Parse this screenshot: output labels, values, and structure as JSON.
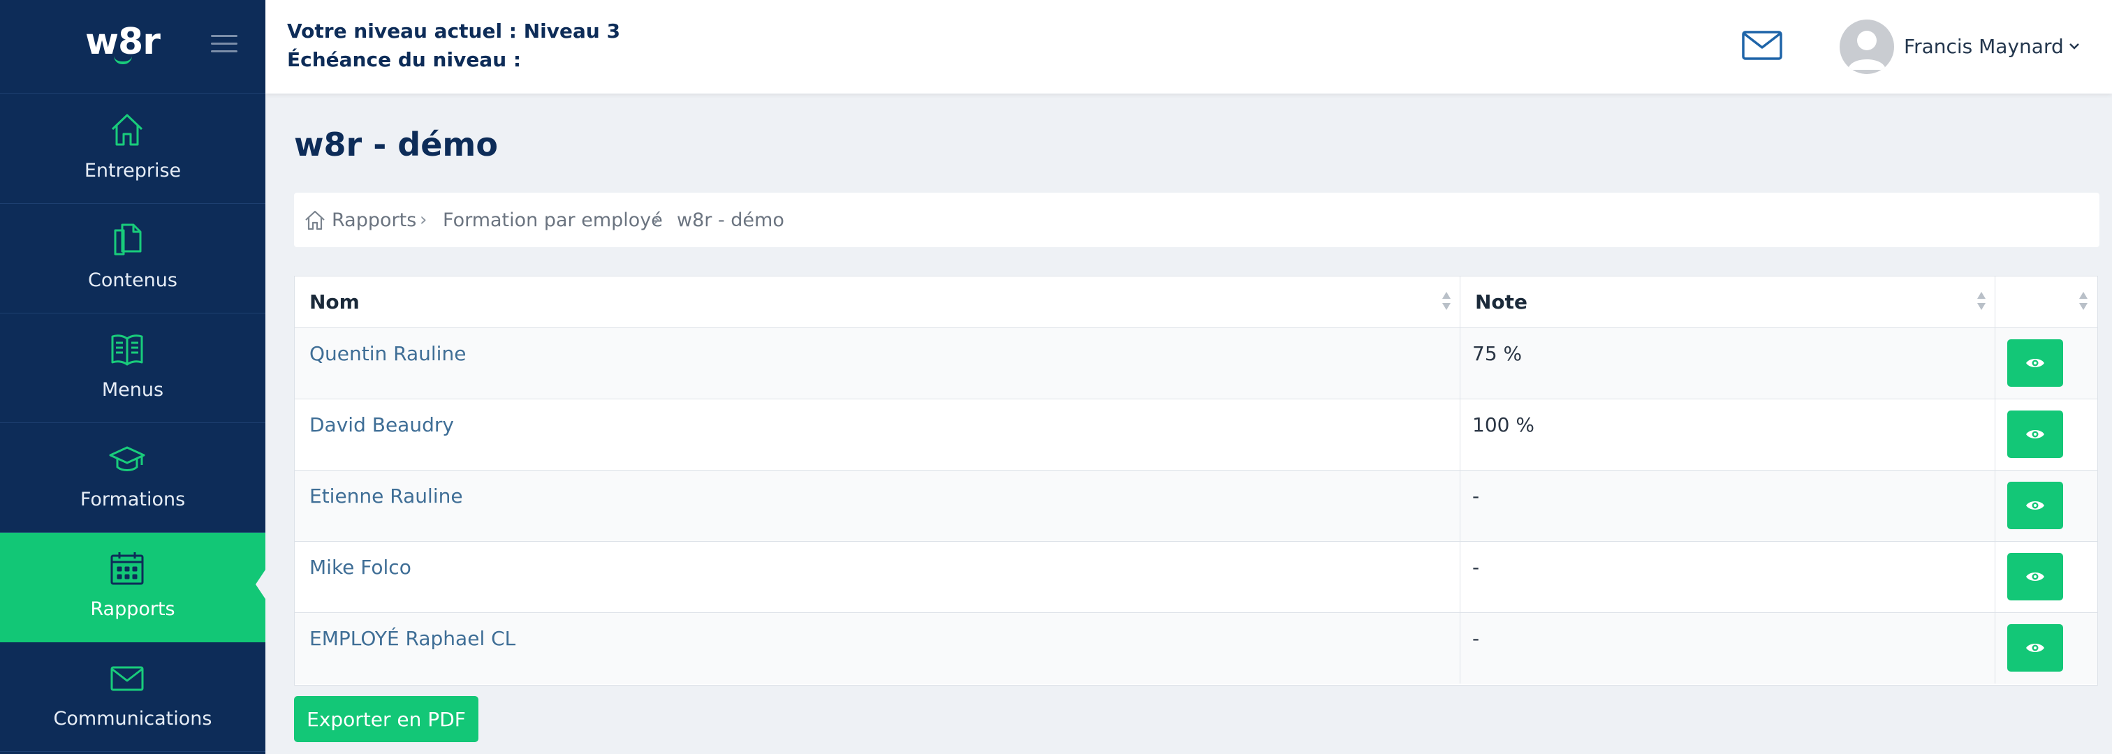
{
  "app": {
    "logo_text": "w8r"
  },
  "sidebar": {
    "items": [
      {
        "label": "Entreprise",
        "icon": "home-icon",
        "active": false
      },
      {
        "label": "Contenus",
        "icon": "documents-icon",
        "active": false
      },
      {
        "label": "Menus",
        "icon": "book-icon",
        "active": false
      },
      {
        "label": "Formations",
        "icon": "graduation-cap-icon",
        "active": false
      },
      {
        "label": "Rapports",
        "icon": "calendar-icon",
        "active": true
      },
      {
        "label": "Communications",
        "icon": "mail-icon",
        "active": false
      }
    ]
  },
  "header": {
    "level_line": "Votre niveau actuel : Niveau 3",
    "deadline_line": "Échéance du niveau :",
    "user_name": "Francis Maynard"
  },
  "main": {
    "title": "w8r - démo",
    "breadcrumb": [
      "Rapports",
      "Formation par employé",
      "w8r - démo"
    ],
    "table": {
      "columns": [
        "Nom",
        "Note",
        ""
      ],
      "rows": [
        {
          "name": "Quentin Rauline",
          "note": "75 %"
        },
        {
          "name": "David Beaudry",
          "note": "100 %"
        },
        {
          "name": "Etienne Rauline",
          "note": "-"
        },
        {
          "name": "Mike Folco",
          "note": "-"
        },
        {
          "name": "EMPLOYÉ Raphael CL",
          "note": "-"
        }
      ]
    },
    "export_label": "Exporter en PDF"
  },
  "colors": {
    "sidebar_bg": "#0d2c58",
    "accent_green": "#13c777",
    "link_blue": "#3f6e96",
    "page_bg": "#eef1f5"
  }
}
